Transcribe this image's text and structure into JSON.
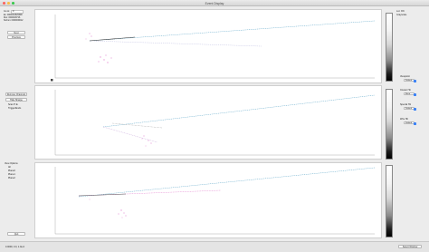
{
  "window": {
    "title": "Event Display"
  },
  "left": {
    "go_to_label": "Go to:",
    "go_to_value": "0",
    "run_line": "Ev: 0000001526698",
    "run_line2": "Run: 0000018716",
    "subrun_line": "Subrun: 0000000012",
    "next_label": "Next",
    "previous_label": "Previous",
    "remove_channels_label": "Remove Channels",
    "hide_sharpe_label": "Hide Sharpe",
    "scan_label": "Scan H.E.",
    "trigger_label": "Trigger/Ends",
    "view_options_title": "View Options",
    "view_items": [
      "All",
      "Plane0",
      "Plane1",
      "Plane2"
    ],
    "quit_label": "Quit"
  },
  "right": {
    "lut_label": "Lut: ON",
    "lut_value": "Grayscale",
    "view_labels": [
      "Viewpoint",
      "Cluster Hit",
      "Special Hit",
      "Wire Hit"
    ],
    "popup_values": [
      "Default",
      "Reco",
      "Default",
      "Default"
    ]
  },
  "status": {
    "left_text": "0.0000, 0.0, 1.0e-0",
    "right_button": "Select Window"
  }
}
